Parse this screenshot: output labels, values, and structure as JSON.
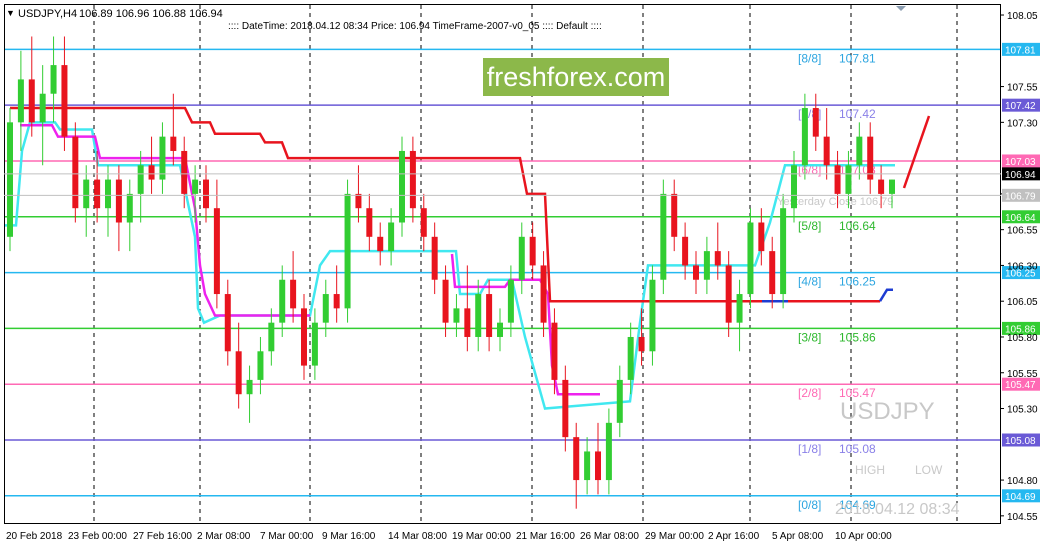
{
  "header": {
    "symbol_tf": "USDJPY,H4",
    "ohlc": "106.89 106.96 106.88 106.94",
    "info": ":::: DateTime: 2018.04.12 08:34    Price: 106.94    TimeFrame-2007-v0_05  ::::  Default  ::::"
  },
  "watermark": {
    "brand": "freshforex.com",
    "symbol": "USDJPY",
    "high_label": "HIGH",
    "low_label": "LOW",
    "datetime": "2018.04.12 08:34"
  },
  "yesterday_close_label": "Yesterday Close 106.79",
  "current_price": "106.94",
  "yesterday_close": "106.79",
  "price_axis_ticks": [
    {
      "label": "108.05",
      "v": 108.05
    },
    {
      "label": "107.55",
      "v": 107.55
    },
    {
      "label": "107.30",
      "v": 107.3
    },
    {
      "label": "106.80",
      "v": 106.8
    },
    {
      "label": "106.55",
      "v": 106.55
    },
    {
      "label": "106.30",
      "v": 106.3
    },
    {
      "label": "106.05",
      "v": 106.05
    },
    {
      "label": "105.80",
      "v": 105.8
    },
    {
      "label": "105.55",
      "v": 105.55
    },
    {
      "label": "105.30",
      "v": 105.3
    },
    {
      "label": "104.80",
      "v": 104.8
    },
    {
      "label": "104.55",
      "v": 104.55
    }
  ],
  "murrey_levels": [
    {
      "label": "[8/8]",
      "price": "107.81",
      "v": 107.81,
      "color": "#25b8f0",
      "label_color": "#2ca5e0"
    },
    {
      "label": "[7/8]",
      "price": "107.42",
      "v": 107.42,
      "color": "#6a5ad6",
      "label_color": "#8a80e8"
    },
    {
      "label": "[6/8]",
      "price": "107.03",
      "v": 107.03,
      "color": "#ff69b4",
      "label_color": "#ff69b4"
    },
    {
      "label": "[5/8]",
      "price": "106.64",
      "v": 106.64,
      "color": "#32cd32",
      "label_color": "#2eb82e"
    },
    {
      "label": "[4/8]",
      "price": "106.25",
      "v": 106.25,
      "color": "#25b8f0",
      "label_color": "#2ca5e0"
    },
    {
      "label": "[3/8]",
      "price": "105.86",
      "v": 105.86,
      "color": "#32cd32",
      "label_color": "#2eb82e"
    },
    {
      "label": "[2/8]",
      "price": "105.47",
      "v": 105.47,
      "color": "#ff69b4",
      "label_color": "#ff69b4"
    },
    {
      "label": "[1/8]",
      "price": "105.08",
      "v": 105.08,
      "color": "#6a5ad6",
      "label_color": "#8a80e8"
    },
    {
      "label": "[0/8]",
      "price": "104.69",
      "v": 104.69,
      "color": "#25b8f0",
      "label_color": "#2ca5e0"
    }
  ],
  "time_axis_labels": [
    "20 Feb 2018",
    "23 Feb 00:00",
    "27 Feb 16:00",
    "2 Mar 08:00",
    "7 Mar 00:00",
    "9 Mar 16:00",
    "14 Mar 08:00",
    "19 Mar 00:00",
    "21 Mar 16:00",
    "26 Mar 08:00",
    "29 Mar 00:00",
    "2 Apr 16:00",
    "5 Apr 08:00",
    "10 Apr 00:00"
  ],
  "colors": {
    "bull": "#32cd32",
    "bear": "#e8141e",
    "red_line": "#e8141e",
    "magenta_line": "#ee22ee",
    "cyan_line": "#40e8f0",
    "blue_line": "#1e3cd2",
    "brand_bg": "#8cb84a"
  },
  "chart_data": {
    "type": "candlestick",
    "ylim": [
      104.5,
      108.12
    ],
    "candles": [
      {
        "o": 106.5,
        "h": 107.4,
        "l": 106.4,
        "c": 107.3
      },
      {
        "o": 107.3,
        "h": 107.8,
        "l": 107.1,
        "c": 107.6
      },
      {
        "o": 107.6,
        "h": 107.9,
        "l": 107.2,
        "c": 107.3
      },
      {
        "o": 107.3,
        "h": 107.7,
        "l": 107.0,
        "c": 107.5
      },
      {
        "o": 107.5,
        "h": 107.9,
        "l": 107.3,
        "c": 107.7
      },
      {
        "o": 107.7,
        "h": 107.9,
        "l": 107.1,
        "c": 107.2
      },
      {
        "o": 107.2,
        "h": 107.3,
        "l": 106.6,
        "c": 106.7
      },
      {
        "o": 106.7,
        "h": 107.0,
        "l": 106.5,
        "c": 106.9
      },
      {
        "o": 106.9,
        "h": 107.1,
        "l": 106.6,
        "c": 106.7
      },
      {
        "o": 106.7,
        "h": 107.0,
        "l": 106.5,
        "c": 106.9
      },
      {
        "o": 106.9,
        "h": 107.0,
        "l": 106.4,
        "c": 106.6
      },
      {
        "o": 106.6,
        "h": 106.9,
        "l": 106.4,
        "c": 106.8
      },
      {
        "o": 106.8,
        "h": 107.1,
        "l": 106.6,
        "c": 107.0
      },
      {
        "o": 107.0,
        "h": 107.2,
        "l": 106.8,
        "c": 106.9
      },
      {
        "o": 106.9,
        "h": 107.3,
        "l": 106.8,
        "c": 107.2
      },
      {
        "o": 107.2,
        "h": 107.5,
        "l": 107.0,
        "c": 107.1
      },
      {
        "o": 107.1,
        "h": 107.2,
        "l": 106.7,
        "c": 106.8
      },
      {
        "o": 106.8,
        "h": 107.0,
        "l": 106.6,
        "c": 106.9
      },
      {
        "o": 106.9,
        "h": 107.0,
        "l": 106.6,
        "c": 106.7
      },
      {
        "o": 106.7,
        "h": 106.9,
        "l": 106.0,
        "c": 106.1
      },
      {
        "o": 106.1,
        "h": 106.2,
        "l": 105.6,
        "c": 105.7
      },
      {
        "o": 105.7,
        "h": 105.9,
        "l": 105.3,
        "c": 105.4
      },
      {
        "o": 105.4,
        "h": 105.6,
        "l": 105.2,
        "c": 105.5
      },
      {
        "o": 105.5,
        "h": 105.8,
        "l": 105.4,
        "c": 105.7
      },
      {
        "o": 105.7,
        "h": 106.0,
        "l": 105.6,
        "c": 105.9
      },
      {
        "o": 105.9,
        "h": 106.3,
        "l": 105.8,
        "c": 106.2
      },
      {
        "o": 106.2,
        "h": 106.4,
        "l": 105.9,
        "c": 106.0
      },
      {
        "o": 106.0,
        "h": 106.1,
        "l": 105.5,
        "c": 105.6
      },
      {
        "o": 105.6,
        "h": 106.0,
        "l": 105.5,
        "c": 105.9
      },
      {
        "o": 105.9,
        "h": 106.2,
        "l": 105.8,
        "c": 106.1
      },
      {
        "o": 106.1,
        "h": 106.3,
        "l": 105.9,
        "c": 106.0
      },
      {
        "o": 106.0,
        "h": 106.9,
        "l": 105.9,
        "c": 106.8
      },
      {
        "o": 106.8,
        "h": 107.0,
        "l": 106.6,
        "c": 106.7
      },
      {
        "o": 106.7,
        "h": 106.8,
        "l": 106.4,
        "c": 106.5
      },
      {
        "o": 106.5,
        "h": 106.6,
        "l": 106.3,
        "c": 106.4
      },
      {
        "o": 106.4,
        "h": 106.7,
        "l": 106.3,
        "c": 106.6
      },
      {
        "o": 106.6,
        "h": 107.2,
        "l": 106.5,
        "c": 107.1
      },
      {
        "o": 107.1,
        "h": 107.2,
        "l": 106.6,
        "c": 106.7
      },
      {
        "o": 106.7,
        "h": 106.8,
        "l": 106.4,
        "c": 106.5
      },
      {
        "o": 106.5,
        "h": 106.6,
        "l": 106.1,
        "c": 106.2
      },
      {
        "o": 106.2,
        "h": 106.3,
        "l": 105.8,
        "c": 105.9
      },
      {
        "o": 105.9,
        "h": 106.1,
        "l": 105.8,
        "c": 106.0
      },
      {
        "o": 106.0,
        "h": 106.3,
        "l": 105.7,
        "c": 105.8
      },
      {
        "o": 105.8,
        "h": 106.2,
        "l": 105.7,
        "c": 106.1
      },
      {
        "o": 106.1,
        "h": 106.2,
        "l": 105.7,
        "c": 105.8
      },
      {
        "o": 105.8,
        "h": 106.0,
        "l": 105.7,
        "c": 105.9
      },
      {
        "o": 105.9,
        "h": 106.3,
        "l": 105.8,
        "c": 106.2
      },
      {
        "o": 106.2,
        "h": 106.6,
        "l": 106.1,
        "c": 106.5
      },
      {
        "o": 106.5,
        "h": 106.6,
        "l": 106.2,
        "c": 106.3
      },
      {
        "o": 106.3,
        "h": 106.4,
        "l": 105.8,
        "c": 105.9
      },
      {
        "o": 105.9,
        "h": 106.0,
        "l": 105.4,
        "c": 105.5
      },
      {
        "o": 105.5,
        "h": 105.6,
        "l": 105.0,
        "c": 105.1
      },
      {
        "o": 105.1,
        "h": 105.2,
        "l": 104.6,
        "c": 104.8
      },
      {
        "o": 104.8,
        "h": 105.1,
        "l": 104.7,
        "c": 105.0
      },
      {
        "o": 105.0,
        "h": 105.2,
        "l": 104.7,
        "c": 104.8
      },
      {
        "o": 104.8,
        "h": 105.3,
        "l": 104.7,
        "c": 105.2
      },
      {
        "o": 105.2,
        "h": 105.6,
        "l": 105.1,
        "c": 105.5
      },
      {
        "o": 105.5,
        "h": 105.9,
        "l": 105.4,
        "c": 105.8
      },
      {
        "o": 105.8,
        "h": 106.0,
        "l": 105.6,
        "c": 105.7
      },
      {
        "o": 105.7,
        "h": 106.3,
        "l": 105.6,
        "c": 106.2
      },
      {
        "o": 106.2,
        "h": 106.9,
        "l": 106.1,
        "c": 106.8
      },
      {
        "o": 106.8,
        "h": 106.9,
        "l": 106.4,
        "c": 106.5
      },
      {
        "o": 106.5,
        "h": 106.6,
        "l": 106.2,
        "c": 106.3
      },
      {
        "o": 106.3,
        "h": 106.4,
        "l": 106.1,
        "c": 106.2
      },
      {
        "o": 106.2,
        "h": 106.5,
        "l": 106.1,
        "c": 106.4
      },
      {
        "o": 106.4,
        "h": 106.6,
        "l": 106.2,
        "c": 106.3
      },
      {
        "o": 106.3,
        "h": 106.4,
        "l": 105.8,
        "c": 105.9
      },
      {
        "o": 105.9,
        "h": 106.2,
        "l": 105.7,
        "c": 106.1
      },
      {
        "o": 106.1,
        "h": 106.7,
        "l": 106.0,
        "c": 106.6
      },
      {
        "o": 106.6,
        "h": 106.7,
        "l": 106.3,
        "c": 106.4
      },
      {
        "o": 106.4,
        "h": 106.5,
        "l": 106.0,
        "c": 106.1
      },
      {
        "o": 106.1,
        "h": 106.8,
        "l": 106.0,
        "c": 106.7
      },
      {
        "o": 106.7,
        "h": 107.1,
        "l": 106.6,
        "c": 107.0
      },
      {
        "o": 107.0,
        "h": 107.5,
        "l": 106.9,
        "c": 107.4
      },
      {
        "o": 107.4,
        "h": 107.5,
        "l": 107.1,
        "c": 107.2
      },
      {
        "o": 107.2,
        "h": 107.4,
        "l": 106.9,
        "c": 107.0
      },
      {
        "o": 107.0,
        "h": 107.1,
        "l": 106.7,
        "c": 106.8
      },
      {
        "o": 106.8,
        "h": 107.1,
        "l": 106.7,
        "c": 107.0
      },
      {
        "o": 107.0,
        "h": 107.3,
        "l": 106.9,
        "c": 107.2
      },
      {
        "o": 107.2,
        "h": 107.3,
        "l": 106.8,
        "c": 106.9
      },
      {
        "o": 106.9,
        "h": 107.0,
        "l": 106.7,
        "c": 106.8
      },
      {
        "o": 106.8,
        "h": 106.9,
        "l": 106.7,
        "c": 106.9
      }
    ]
  }
}
